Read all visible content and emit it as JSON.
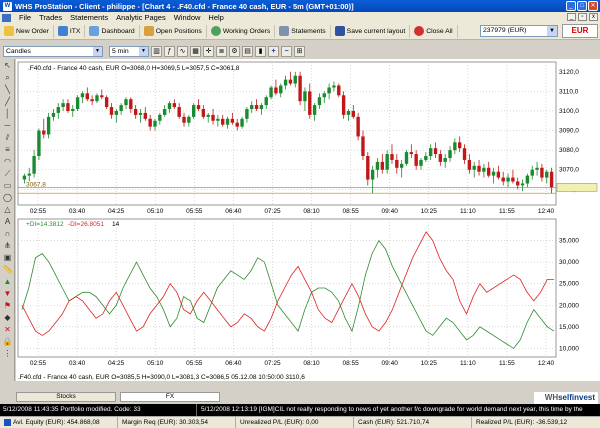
{
  "window": {
    "title": "WHS ProStation - Client - philippe - [Chart 4 - .F40.cfd - France 40 cash, EUR - 5m (GMT+01:00)]"
  },
  "menu": {
    "items": [
      "File",
      "Trades",
      "Statements",
      "Analytic Pages",
      "Window",
      "Help"
    ]
  },
  "toolbar": {
    "new_order": "New Order",
    "itx": "ITX",
    "dashboard": "Dashboard",
    "open_positions": "Open Positions",
    "working_orders": "Working Orders",
    "statements": "Statements",
    "save_layout": "Save current layout",
    "close_all": "Close All",
    "account": "237979 (EUR)",
    "currency": "EUR"
  },
  "chart_toolbar": {
    "chart_type": "Candles",
    "interval": "5 min"
  },
  "chart_data": [
    {
      "type": "candlestick",
      "legend": ".F40.cfd - France 40 cash, EUR O=3068,0 H=3069,5 L=3057,5 C=3061,8",
      "x_ticks": [
        "02:55",
        "03:40",
        "04:25",
        "05:10",
        "05:55",
        "06:40",
        "07:25",
        "08:10",
        "08:55",
        "09:40",
        "10:25",
        "11:10",
        "11:55",
        "12:40"
      ],
      "y_ticks": [
        3110,
        3100,
        3090,
        3080,
        3070,
        3060
      ],
      "y_tick_labels": [
        "3110,0",
        "3100,0",
        "3090,0",
        "3080,0",
        "3070,0",
        "3060,0"
      ],
      "price_marker": "3067,8",
      "y_axis_max_label": "3120,0",
      "ylim": [
        3052,
        3125
      ],
      "candles": [
        {
          "o": 3065,
          "h": 3068,
          "l": 3063,
          "c": 3067
        },
        {
          "o": 3067,
          "h": 3071,
          "l": 3064,
          "c": 3068
        },
        {
          "o": 3068,
          "h": 3080,
          "l": 3066,
          "c": 3077
        },
        {
          "o": 3077,
          "h": 3091,
          "l": 3075,
          "c": 3090
        },
        {
          "o": 3090,
          "h": 3096,
          "l": 3086,
          "c": 3088
        },
        {
          "o": 3088,
          "h": 3099,
          "l": 3086,
          "c": 3097
        },
        {
          "o": 3097,
          "h": 3101,
          "l": 3095,
          "c": 3099
        },
        {
          "o": 3099,
          "h": 3104,
          "l": 3096,
          "c": 3102
        },
        {
          "o": 3102,
          "h": 3106,
          "l": 3100,
          "c": 3104
        },
        {
          "o": 3104,
          "h": 3106,
          "l": 3099,
          "c": 3100
        },
        {
          "o": 3100,
          "h": 3103,
          "l": 3097,
          "c": 3101
        },
        {
          "o": 3101,
          "h": 3108,
          "l": 3100,
          "c": 3107
        },
        {
          "o": 3107,
          "h": 3110,
          "l": 3104,
          "c": 3109
        },
        {
          "o": 3109,
          "h": 3112,
          "l": 3105,
          "c": 3106
        },
        {
          "o": 3106,
          "h": 3108,
          "l": 3103,
          "c": 3105
        },
        {
          "o": 3105,
          "h": 3109,
          "l": 3104,
          "c": 3108
        },
        {
          "o": 3108,
          "h": 3111,
          "l": 3106,
          "c": 3107
        },
        {
          "o": 3107,
          "h": 3108,
          "l": 3101,
          "c": 3102
        },
        {
          "o": 3102,
          "h": 3104,
          "l": 3096,
          "c": 3098
        },
        {
          "o": 3098,
          "h": 3101,
          "l": 3094,
          "c": 3100
        },
        {
          "o": 3100,
          "h": 3104,
          "l": 3098,
          "c": 3103
        },
        {
          "o": 3103,
          "h": 3107,
          "l": 3101,
          "c": 3106
        },
        {
          "o": 3106,
          "h": 3107,
          "l": 3099,
          "c": 3101
        },
        {
          "o": 3101,
          "h": 3103,
          "l": 3096,
          "c": 3098
        },
        {
          "o": 3098,
          "h": 3101,
          "l": 3094,
          "c": 3099
        },
        {
          "o": 3099,
          "h": 3102,
          "l": 3095,
          "c": 3096
        },
        {
          "o": 3096,
          "h": 3098,
          "l": 3090,
          "c": 3092
        },
        {
          "o": 3092,
          "h": 3096,
          "l": 3090,
          "c": 3095
        },
        {
          "o": 3095,
          "h": 3099,
          "l": 3093,
          "c": 3098
        },
        {
          "o": 3098,
          "h": 3103,
          "l": 3097,
          "c": 3101
        },
        {
          "o": 3101,
          "h": 3105,
          "l": 3099,
          "c": 3104
        },
        {
          "o": 3104,
          "h": 3106,
          "l": 3101,
          "c": 3102
        },
        {
          "o": 3102,
          "h": 3104,
          "l": 3096,
          "c": 3097
        },
        {
          "o": 3097,
          "h": 3099,
          "l": 3092,
          "c": 3094
        },
        {
          "o": 3094,
          "h": 3098,
          "l": 3092,
          "c": 3097
        },
        {
          "o": 3097,
          "h": 3104,
          "l": 3096,
          "c": 3103
        },
        {
          "o": 3103,
          "h": 3106,
          "l": 3100,
          "c": 3101
        },
        {
          "o": 3101,
          "h": 3103,
          "l": 3096,
          "c": 3097
        },
        {
          "o": 3097,
          "h": 3099,
          "l": 3094,
          "c": 3098
        },
        {
          "o": 3098,
          "h": 3101,
          "l": 3093,
          "c": 3095
        },
        {
          "o": 3095,
          "h": 3098,
          "l": 3092,
          "c": 3096
        },
        {
          "o": 3096,
          "h": 3098,
          "l": 3092,
          "c": 3093
        },
        {
          "o": 3093,
          "h": 3097,
          "l": 3091,
          "c": 3096
        },
        {
          "o": 3096,
          "h": 3099,
          "l": 3093,
          "c": 3094
        },
        {
          "o": 3094,
          "h": 3096,
          "l": 3090,
          "c": 3092
        },
        {
          "o": 3092,
          "h": 3097,
          "l": 3091,
          "c": 3096
        },
        {
          "o": 3096,
          "h": 3102,
          "l": 3094,
          "c": 3101
        },
        {
          "o": 3101,
          "h": 3105,
          "l": 3099,
          "c": 3103
        },
        {
          "o": 3103,
          "h": 3106,
          "l": 3100,
          "c": 3101
        },
        {
          "o": 3101,
          "h": 3104,
          "l": 3098,
          "c": 3103
        },
        {
          "o": 3103,
          "h": 3108,
          "l": 3101,
          "c": 3107
        },
        {
          "o": 3107,
          "h": 3113,
          "l": 3106,
          "c": 3112
        },
        {
          "o": 3112,
          "h": 3116,
          "l": 3108,
          "c": 3109
        },
        {
          "o": 3109,
          "h": 3114,
          "l": 3107,
          "c": 3113
        },
        {
          "o": 3113,
          "h": 3118,
          "l": 3111,
          "c": 3116
        },
        {
          "o": 3116,
          "h": 3120,
          "l": 3113,
          "c": 3114
        },
        {
          "o": 3114,
          "h": 3120,
          "l": 3112,
          "c": 3118
        },
        {
          "o": 3118,
          "h": 3120,
          "l": 3103,
          "c": 3105
        },
        {
          "o": 3105,
          "h": 3112,
          "l": 3100,
          "c": 3110
        },
        {
          "o": 3110,
          "h": 3114,
          "l": 3096,
          "c": 3098
        },
        {
          "o": 3098,
          "h": 3104,
          "l": 3095,
          "c": 3103
        },
        {
          "o": 3103,
          "h": 3109,
          "l": 3101,
          "c": 3107
        },
        {
          "o": 3107,
          "h": 3110,
          "l": 3104,
          "c": 3109
        },
        {
          "o": 3109,
          "h": 3114,
          "l": 3106,
          "c": 3112
        },
        {
          "o": 3112,
          "h": 3115,
          "l": 3110,
          "c": 3113
        },
        {
          "o": 3113,
          "h": 3114,
          "l": 3107,
          "c": 3108
        },
        {
          "o": 3108,
          "h": 3110,
          "l": 3096,
          "c": 3098
        },
        {
          "o": 3098,
          "h": 3101,
          "l": 3095,
          "c": 3100
        },
        {
          "o": 3100,
          "h": 3103,
          "l": 3096,
          "c": 3097
        },
        {
          "o": 3097,
          "h": 3099,
          "l": 3085,
          "c": 3087
        },
        {
          "o": 3087,
          "h": 3090,
          "l": 3075,
          "c": 3077
        },
        {
          "o": 3077,
          "h": 3079,
          "l": 3062,
          "c": 3065
        },
        {
          "o": 3065,
          "h": 3072,
          "l": 3058,
          "c": 3070
        },
        {
          "o": 3070,
          "h": 3076,
          "l": 3066,
          "c": 3074
        },
        {
          "o": 3074,
          "h": 3078,
          "l": 3068,
          "c": 3070
        },
        {
          "o": 3070,
          "h": 3080,
          "l": 3068,
          "c": 3078
        },
        {
          "o": 3078,
          "h": 3083,
          "l": 3073,
          "c": 3075
        },
        {
          "o": 3075,
          "h": 3078,
          "l": 3068,
          "c": 3071
        },
        {
          "o": 3071,
          "h": 3075,
          "l": 3066,
          "c": 3073
        },
        {
          "o": 3073,
          "h": 3080,
          "l": 3072,
          "c": 3079
        },
        {
          "o": 3079,
          "h": 3083,
          "l": 3076,
          "c": 3078
        },
        {
          "o": 3078,
          "h": 3080,
          "l": 3070,
          "c": 3072
        },
        {
          "o": 3072,
          "h": 3076,
          "l": 3070,
          "c": 3075
        },
        {
          "o": 3075,
          "h": 3079,
          "l": 3074,
          "c": 3077
        },
        {
          "o": 3077,
          "h": 3083,
          "l": 3075,
          "c": 3081
        },
        {
          "o": 3081,
          "h": 3084,
          "l": 3076,
          "c": 3078
        },
        {
          "o": 3078,
          "h": 3080,
          "l": 3072,
          "c": 3074
        },
        {
          "o": 3074,
          "h": 3078,
          "l": 3071,
          "c": 3076
        },
        {
          "o": 3076,
          "h": 3082,
          "l": 3074,
          "c": 3080
        },
        {
          "o": 3080,
          "h": 3086,
          "l": 3078,
          "c": 3084
        },
        {
          "o": 3084,
          "h": 3087,
          "l": 3079,
          "c": 3081
        },
        {
          "o": 3081,
          "h": 3083,
          "l": 3073,
          "c": 3075
        },
        {
          "o": 3075,
          "h": 3078,
          "l": 3068,
          "c": 3070
        },
        {
          "o": 3070,
          "h": 3074,
          "l": 3066,
          "c": 3072
        },
        {
          "o": 3072,
          "h": 3075,
          "l": 3067,
          "c": 3069
        },
        {
          "o": 3069,
          "h": 3073,
          "l": 3066,
          "c": 3071
        },
        {
          "o": 3071,
          "h": 3074,
          "l": 3066,
          "c": 3067
        },
        {
          "o": 3067,
          "h": 3071,
          "l": 3063,
          "c": 3069
        },
        {
          "o": 3069,
          "h": 3072,
          "l": 3065,
          "c": 3066
        },
        {
          "o": 3066,
          "h": 3069,
          "l": 3062,
          "c": 3064
        },
        {
          "o": 3064,
          "h": 3068,
          "l": 3061,
          "c": 3066
        },
        {
          "o": 3066,
          "h": 3070,
          "l": 3063,
          "c": 3064
        },
        {
          "o": 3064,
          "h": 3066,
          "l": 3060,
          "c": 3062
        },
        {
          "o": 3062,
          "h": 3065,
          "l": 3059,
          "c": 3063
        },
        {
          "o": 3063,
          "h": 3068,
          "l": 3061,
          "c": 3067
        },
        {
          "o": 3067,
          "h": 3072,
          "l": 3065,
          "c": 3070
        },
        {
          "o": 3070,
          "h": 3074,
          "l": 3067,
          "c": 3071
        },
        {
          "o": 3071,
          "h": 3073,
          "l": 3064,
          "c": 3066
        },
        {
          "o": 3066,
          "h": 3070,
          "l": 3063,
          "c": 3069
        },
        {
          "o": 3069,
          "h": 3071,
          "l": 3058,
          "c": 3061
        }
      ]
    },
    {
      "type": "line",
      "legend_plus": "+DI=14.3812",
      "legend_minus": "-DI=26.8051",
      "legend_period": "14",
      "y_ticks": [
        35,
        30,
        25,
        20,
        15,
        10
      ],
      "y_tick_labels": [
        "35,000",
        "30,000",
        "25,000",
        "20,000",
        "15,000",
        "10,000"
      ],
      "ylim": [
        8,
        40
      ],
      "series": [
        {
          "name": "+DI",
          "color": "#2e8b2e",
          "values": [
            19,
            24,
            31,
            32,
            30,
            27,
            24,
            21,
            22,
            23,
            23,
            22,
            20,
            18,
            20,
            24,
            27,
            30,
            27,
            24,
            22,
            19,
            15,
            17,
            22,
            21,
            17,
            16,
            20,
            24,
            26,
            28,
            27,
            26,
            28,
            31,
            30,
            25,
            20,
            18,
            16,
            14,
            19,
            23,
            24,
            24,
            23,
            21,
            17,
            14,
            20,
            27,
            32,
            35,
            33,
            29,
            26,
            23,
            20,
            17,
            14,
            13,
            15,
            17,
            16,
            14,
            12,
            13,
            15,
            14,
            13,
            12,
            11,
            10,
            12,
            16,
            19,
            17,
            15,
            14
          ]
        },
        {
          "name": "-DI",
          "color": "#dd2222",
          "values": [
            20,
            17,
            14,
            13,
            14,
            16,
            18,
            21,
            22,
            21,
            19,
            17,
            18,
            21,
            23,
            20,
            17,
            14,
            15,
            18,
            20,
            22,
            25,
            23,
            19,
            18,
            21,
            23,
            21,
            19,
            17,
            15,
            16,
            18,
            17,
            15,
            14,
            17,
            21,
            24,
            27,
            29,
            26,
            23,
            19,
            17,
            16,
            19,
            22,
            25,
            22,
            18,
            15,
            14,
            16,
            19,
            23,
            27,
            31,
            34,
            37,
            35,
            31,
            28,
            26,
            21,
            18,
            22,
            25,
            23,
            24,
            25,
            26,
            27,
            26,
            23,
            21,
            23,
            26,
            26
          ]
        }
      ],
      "x_ticks": [
        "02:55",
        "03:40",
        "04:25",
        "05:10",
        "05:55",
        "06:40",
        "07:25",
        "08:10",
        "08:55",
        "09:40",
        "10:25",
        "11:10",
        "11:55",
        "12:40"
      ]
    }
  ],
  "chart_footer": {
    "legend": ".F40.cfd - France 40 cash, EUR O=3085,5 H=3090,0 L=3081,3 C=3086,5  05.12.08 10:50:00  3110,6"
  },
  "tabs": [
    {
      "label": "Stocks"
    },
    {
      "label": "FX"
    }
  ],
  "brand": {
    "prefix": "WH",
    "suffix": "selfinvest"
  },
  "news": {
    "left": "5/12/2008 11:43:35 Portfolio modified. Code: 33",
    "right": "5/12/2008 12:13:19 [IGM]CIL not really responding to news of yet another f/c downgrade for world demand next year, this time by the"
  },
  "status": {
    "equity": "Avl. Equity (EUR): 454.868,08",
    "margin": "Margin Req (EUR): 30.303,54",
    "unrealized": "Unrealized P/L (EUR): 0,00",
    "cash": "Cash (EUR): 521.710,74",
    "realized": "Realized P/L (EUR): -36.539,12"
  },
  "colors": {
    "bull": "#1a8a2e",
    "bear": "#c01818",
    "grid": "#c0c0c0",
    "accent": "#0448b8"
  }
}
